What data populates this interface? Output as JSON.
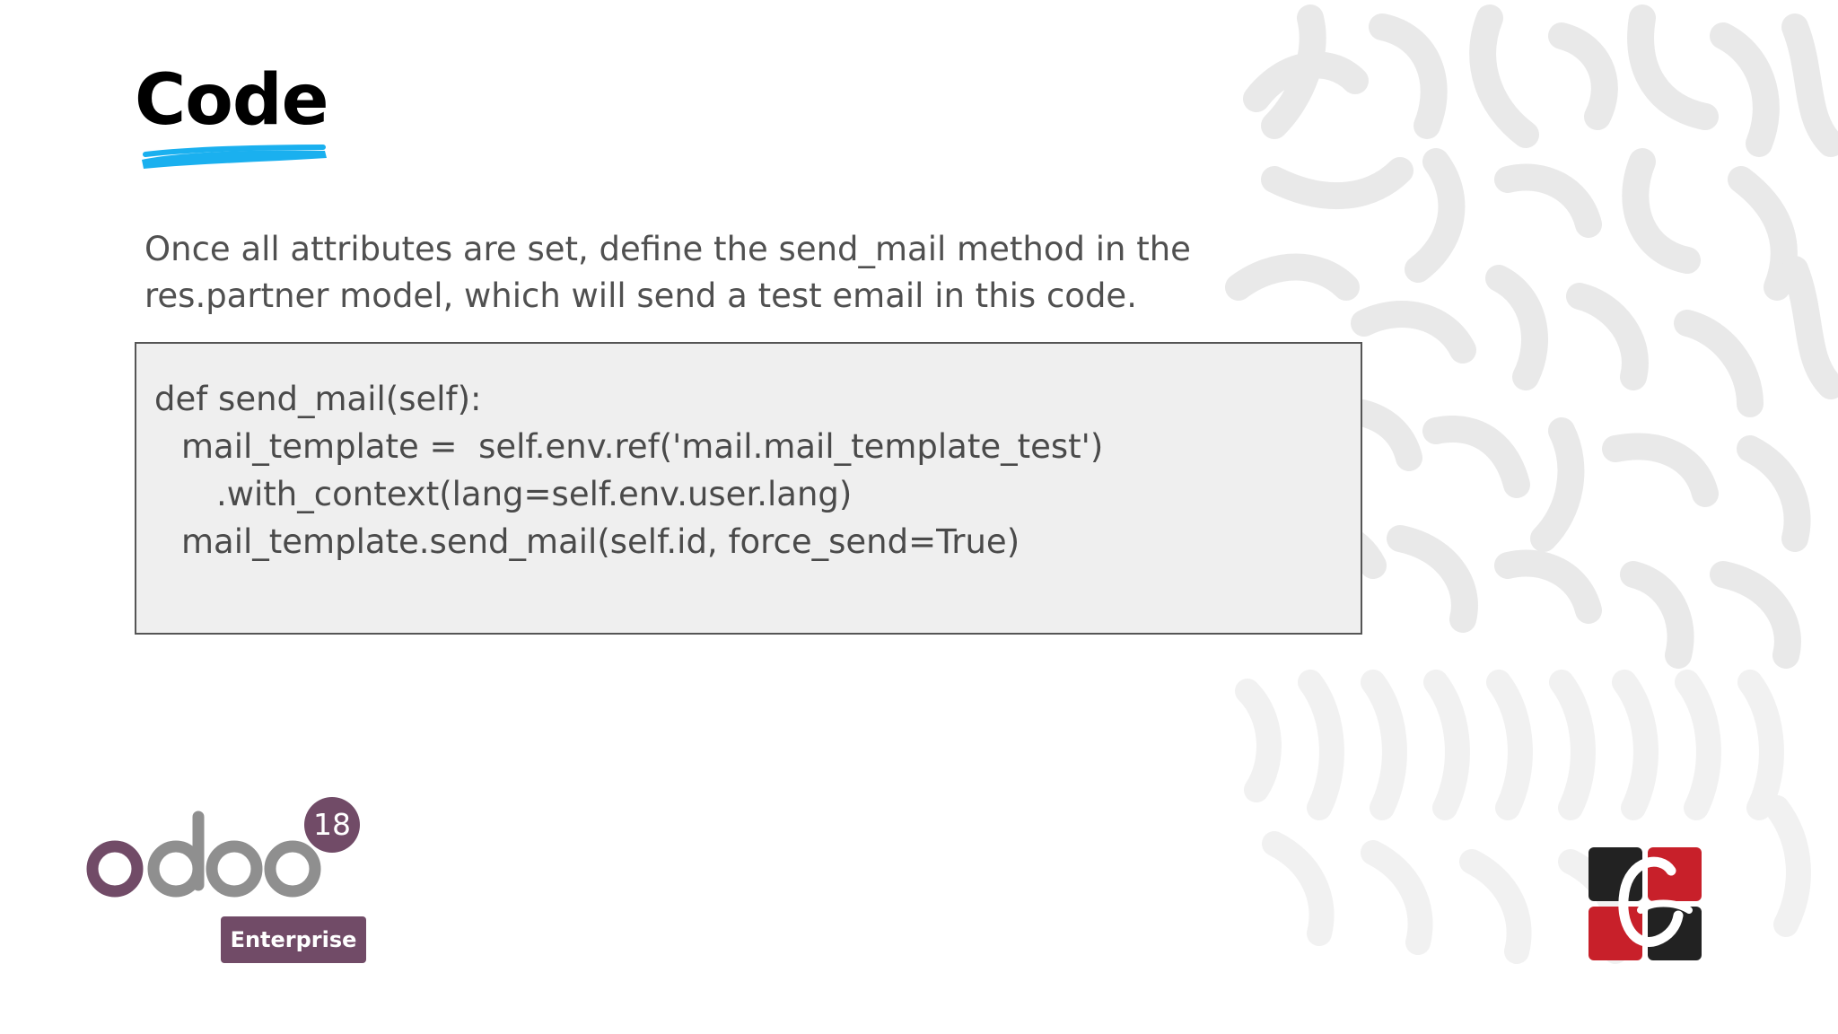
{
  "slide": {
    "title": "Code",
    "intro": "Once all attributes are set, define the send_mail method in the res.partner model, which will send a test email in this code.",
    "code_lines": [
      "def send_mail(self):",
      "mail_template =  self.env.ref('mail.mail_template_test')",
      ".with_context(lang=self.env.user.lang)",
      "mail_template.send_mail(self.id, force_send=True)"
    ]
  },
  "branding": {
    "product_logo": "odoo",
    "version": "18",
    "edition": "Enterprise",
    "company_logo": "Cybrosys"
  },
  "colors": {
    "accent_underline": "#1ab0ef",
    "odoo_purple": "#714b67",
    "odoo_grey": "#8f8f8f",
    "code_background": "#efefef",
    "company_red": "#c8202a",
    "company_dark": "#222222"
  },
  "icons": {
    "underline": "brush-stroke-underline",
    "background": "squiggle-pattern"
  }
}
